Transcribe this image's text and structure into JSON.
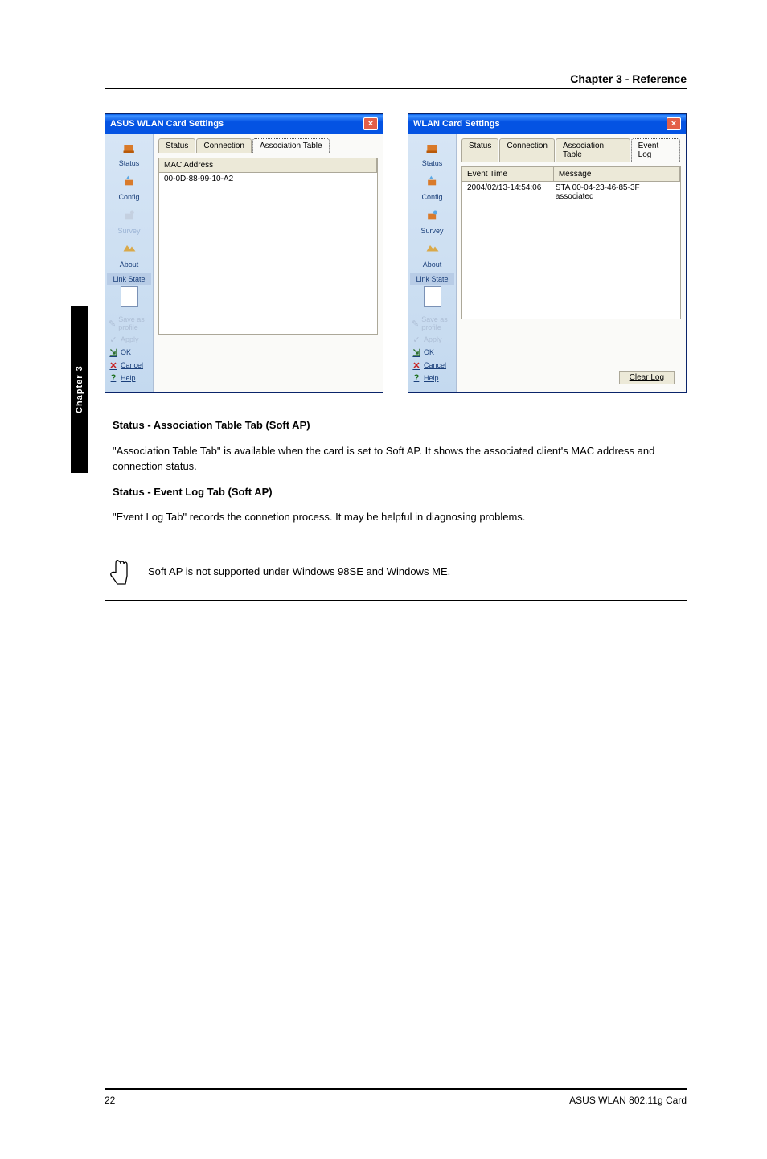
{
  "header": {
    "chapter_title": "Chapter 3 - Reference"
  },
  "black_tab": "Chapter 3",
  "left_dialog": {
    "title": "ASUS WLAN Card Settings",
    "tabs": [
      "Status",
      "Connection",
      "Association Table"
    ],
    "active_tab_index": 2,
    "col_header": "MAC Address",
    "row_value": "00-0D-88-99-10-A2"
  },
  "right_dialog": {
    "title": "WLAN Card Settings",
    "tabs": [
      "Status",
      "Connection",
      "Association Table",
      "Event Log"
    ],
    "active_tab_index": 3,
    "col1_header": "Event Time",
    "col2_header": "Message",
    "row_time": "2004/02/13-14:54:06",
    "row_msg": "STA 00-04-23-46-85-3F associated",
    "clear_log_label": "Clear Log"
  },
  "sidebar": {
    "status": "Status",
    "config": "Config",
    "survey": "Survey",
    "about": "About",
    "link_state": "Link State",
    "save_profile": "Save as profile",
    "apply": "Apply",
    "ok": "OK",
    "cancel": "Cancel",
    "help": "Help"
  },
  "body_text": {
    "assoc_title": "Status - Association Table Tab (Soft AP)",
    "assoc_para": "\"Association Table Tab\" is available when the card is set to Soft AP. It shows the associated client's MAC address and connection status.",
    "eventlog_title": "Status - Event Log Tab (Soft AP)",
    "eventlog_para": "\"Event Log Tab\" records the connetion process. It may be helpful in diagnosing problems.",
    "note": "Soft AP is not supported under Windows 98SE and Windows ME."
  },
  "footer": {
    "page": "22",
    "product": "ASUS WLAN 802.11g Card"
  }
}
